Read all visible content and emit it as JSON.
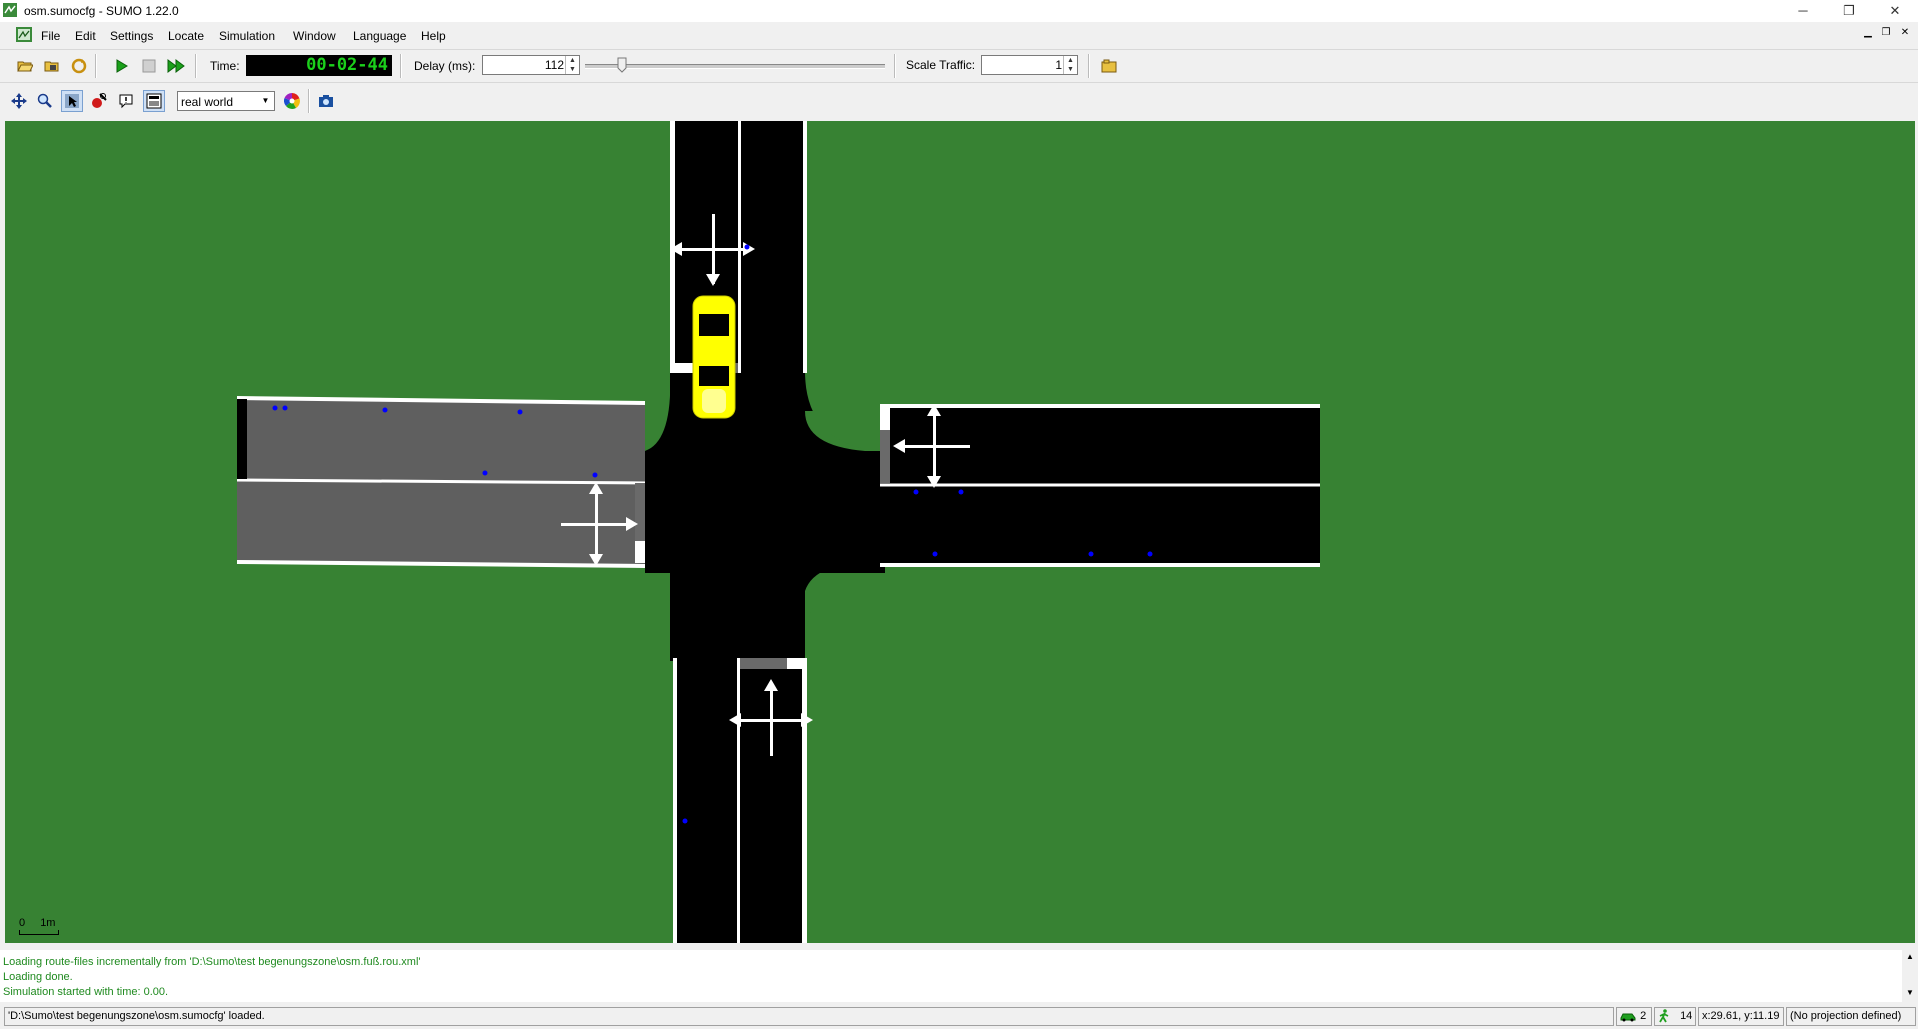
{
  "window": {
    "title": "osm.sumocfg - SUMO 1.22.0",
    "minimize_glyph": "─",
    "restore_glyph": "❐",
    "close_glyph": "✕"
  },
  "menu": {
    "file": "File",
    "edit": "Edit",
    "settings": "Settings",
    "locate": "Locate",
    "simulation": "Simulation",
    "window": "Window",
    "language": "Language",
    "help": "Help"
  },
  "toolbar": {
    "time_label": "Time:",
    "time_value": "00-02-44",
    "delay_label": "Delay (ms):",
    "delay_value": "112",
    "delay_fraction": 0.11,
    "scale_label": "Scale Traffic:",
    "scale_value": "1"
  },
  "view_toolbar": {
    "scheme_value": "real world"
  },
  "canvas": {
    "scale_zero": "0",
    "scale_unit": "1m"
  },
  "messages": [
    "Loading route-files incrementally from 'D:\\Sumo\\test begenungszone\\osm.fuß.rou.xml'",
    "Loading done.",
    "Simulation started with time: 0.00."
  ],
  "status": {
    "message": "'D:\\Sumo\\test begenungszone\\osm.sumocfg' loaded.",
    "vehicles": "2",
    "persons": "14",
    "coords": "x:29.61, y:11.19",
    "projection": "(No projection defined)"
  },
  "colors": {
    "grass": "#378233",
    "road": "#000000",
    "sidewalk": "#5f5f5f",
    "vehicle": "#ffff00",
    "pedestrian": "#0000ff",
    "lcd_text": "#1bd01b",
    "message_text": "#1f8a1f"
  }
}
